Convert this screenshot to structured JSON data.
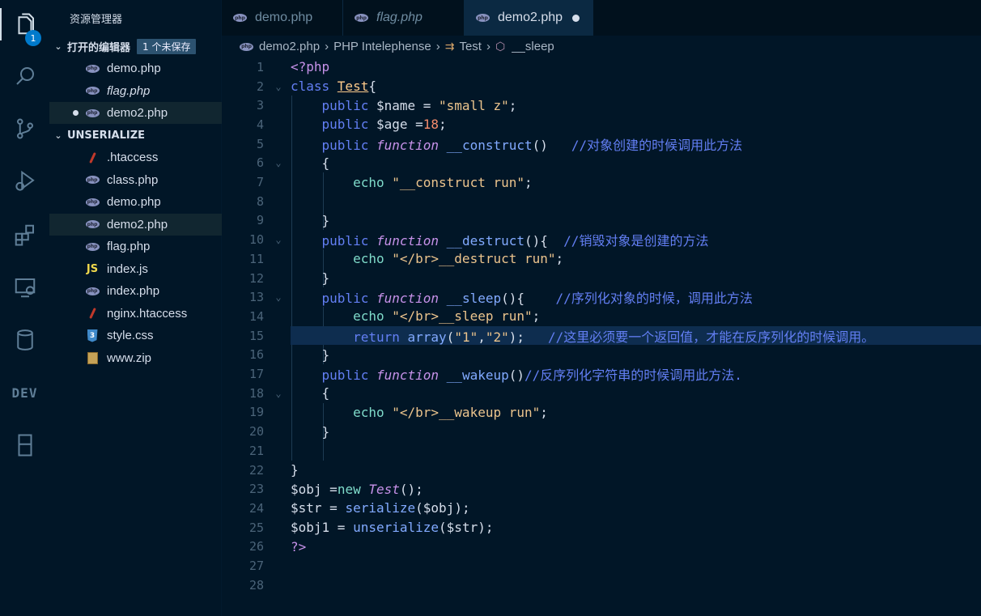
{
  "activity_bar": {
    "badge": "1",
    "dev_label": "DEV",
    "icons": [
      "files-icon",
      "search-icon",
      "source-control-icon",
      "run-debug-icon",
      "extensions-icon",
      "remote-explorer-icon",
      "database-icon",
      "dev-icon",
      "panel-icon"
    ]
  },
  "sidebar": {
    "title": "资源管理器",
    "open_editors": {
      "label": "打开的编辑器",
      "unsaved": "1 个未保存",
      "files": [
        {
          "name": "demo.php",
          "italic": false,
          "dirty": false
        },
        {
          "name": "flag.php",
          "italic": true,
          "dirty": false
        },
        {
          "name": "demo2.php",
          "italic": false,
          "dirty": true
        }
      ]
    },
    "folder": {
      "label": "UNSERIALIZE",
      "files": [
        {
          "name": ".htaccess",
          "type": "htaccess"
        },
        {
          "name": "class.php",
          "type": "php"
        },
        {
          "name": "demo.php",
          "type": "php"
        },
        {
          "name": "demo2.php",
          "type": "php"
        },
        {
          "name": "flag.php",
          "type": "php"
        },
        {
          "name": "index.js",
          "type": "js"
        },
        {
          "name": "index.php",
          "type": "php"
        },
        {
          "name": "nginx.htaccess",
          "type": "htaccess"
        },
        {
          "name": "style.css",
          "type": "css"
        },
        {
          "name": "www.zip",
          "type": "zip"
        }
      ]
    }
  },
  "tabs": [
    {
      "label": "demo.php",
      "italic": false,
      "active": false
    },
    {
      "label": "flag.php",
      "italic": true,
      "active": false
    },
    {
      "label": "demo2.php",
      "italic": false,
      "active": true
    }
  ],
  "breadcrumb": {
    "file": "demo2.php",
    "lang": "PHP Intelephense",
    "class": "Test",
    "method": "__sleep"
  },
  "editor": {
    "highlighted_line": 15,
    "lines": [
      [
        [
          "t-tag",
          "<?php"
        ]
      ],
      [
        [
          "t-mod",
          "class "
        ],
        [
          "t-cls",
          "Test"
        ],
        [
          "t-plain",
          "{"
        ]
      ],
      [
        [
          "t-mod",
          "    public "
        ],
        [
          "t-var",
          "$name "
        ],
        [
          "t-plain",
          "= "
        ],
        [
          "t-str",
          "\"small z\""
        ],
        [
          "t-plain",
          ";"
        ]
      ],
      [
        [
          "t-mod",
          "    public "
        ],
        [
          "t-var",
          "$age "
        ],
        [
          "t-plain",
          "="
        ],
        [
          "t-num",
          "18"
        ],
        [
          "t-plain",
          ";"
        ]
      ],
      [
        [
          "t-mod",
          "    public "
        ],
        [
          "t-fn",
          "function "
        ],
        [
          "t-call",
          "__construct"
        ],
        [
          "t-plain",
          "()   "
        ],
        [
          "t-mod",
          "//对象创建的时候调用此方法"
        ]
      ],
      [
        [
          "t-plain",
          "    {"
        ]
      ],
      [
        [
          "t-echo",
          "        echo "
        ],
        [
          "t-str",
          "\"__construct run\""
        ],
        [
          "t-plain",
          ";"
        ]
      ],
      [
        [
          "t-plain",
          ""
        ]
      ],
      [
        [
          "t-plain",
          "    }"
        ]
      ],
      [
        [
          "t-mod",
          "    public "
        ],
        [
          "t-fn",
          "function "
        ],
        [
          "t-call",
          "__destruct"
        ],
        [
          "t-plain",
          "(){  "
        ],
        [
          "t-mod",
          "//销毁对象是创建的方法"
        ]
      ],
      [
        [
          "t-echo",
          "        echo "
        ],
        [
          "t-str",
          "\"</br>__destruct run\""
        ],
        [
          "t-plain",
          ";"
        ]
      ],
      [
        [
          "t-plain",
          "    }"
        ]
      ],
      [
        [
          "t-mod",
          "    public "
        ],
        [
          "t-fn",
          "function "
        ],
        [
          "t-call",
          "__sleep"
        ],
        [
          "t-plain",
          "(){    "
        ],
        [
          "t-mod",
          "//序列化对象的时候，调用此方法"
        ]
      ],
      [
        [
          "t-echo",
          "        echo "
        ],
        [
          "t-str",
          "\"</br>__sleep run\""
        ],
        [
          "t-plain",
          ";"
        ]
      ],
      [
        [
          "t-mod",
          "        return "
        ],
        [
          "t-call",
          "array"
        ],
        [
          "t-plain",
          "("
        ],
        [
          "t-str",
          "\"1\""
        ],
        [
          "t-plain",
          ","
        ],
        [
          "t-str",
          "\"2\""
        ],
        [
          "t-plain",
          ");   "
        ],
        [
          "t-mod",
          "//这里必须要一个返回值，才能在反序列化的时候调用。"
        ]
      ],
      [
        [
          "t-plain",
          "    }"
        ]
      ],
      [
        [
          "t-mod",
          "    public "
        ],
        [
          "t-fn",
          "function "
        ],
        [
          "t-call",
          "__wakeup"
        ],
        [
          "t-plain",
          "()"
        ],
        [
          "t-mod",
          "//反序列化字符串的时候调用此方法."
        ]
      ],
      [
        [
          "t-plain",
          "    {"
        ]
      ],
      [
        [
          "t-echo",
          "        echo "
        ],
        [
          "t-str",
          "\"</br>__wakeup run\""
        ],
        [
          "t-plain",
          ";"
        ]
      ],
      [
        [
          "t-plain",
          "    }"
        ]
      ],
      [
        [
          "t-plain",
          ""
        ]
      ],
      [
        [
          "t-plain",
          "}"
        ]
      ],
      [
        [
          "t-var",
          "$obj "
        ],
        [
          "t-plain",
          "="
        ],
        [
          "t-new",
          "new "
        ],
        [
          "t-fn",
          "Test"
        ],
        [
          "t-plain",
          "();"
        ]
      ],
      [
        [
          "t-var",
          "$str "
        ],
        [
          "t-plain",
          "= "
        ],
        [
          "t-call",
          "serialize"
        ],
        [
          "t-plain",
          "("
        ],
        [
          "t-var",
          "$obj"
        ],
        [
          "t-plain",
          ");"
        ]
      ],
      [
        [
          "t-var",
          "$obj1 "
        ],
        [
          "t-plain",
          "= "
        ],
        [
          "t-call",
          "unserialize"
        ],
        [
          "t-plain",
          "("
        ],
        [
          "t-var",
          "$str"
        ],
        [
          "t-plain",
          ");"
        ]
      ],
      [
        [
          "t-tag",
          "?>"
        ]
      ],
      [
        [
          "t-plain",
          ""
        ]
      ],
      [
        [
          "t-plain",
          ""
        ]
      ]
    ],
    "fold_lines": [
      2,
      6,
      10,
      13,
      18
    ]
  }
}
